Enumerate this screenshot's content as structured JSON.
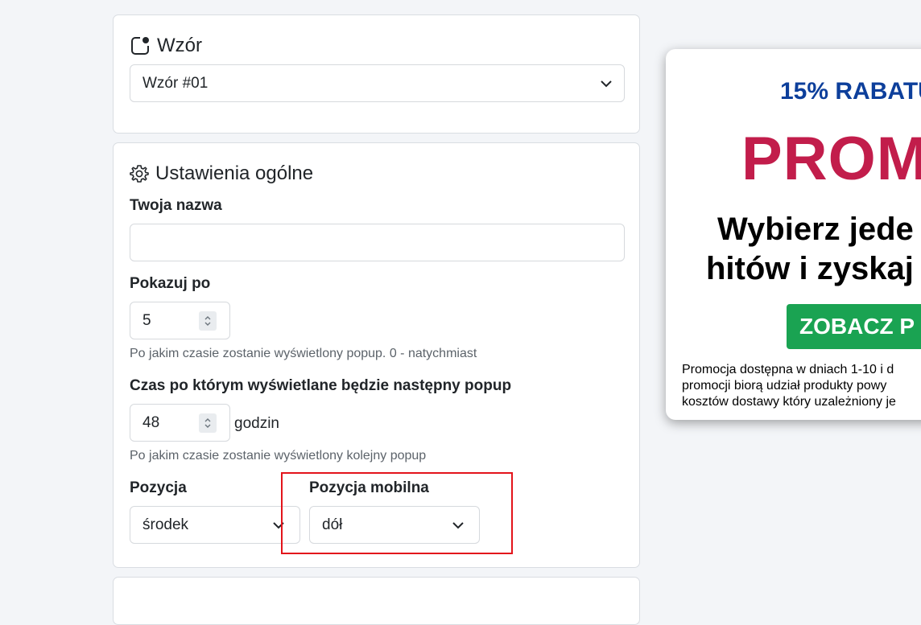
{
  "template_card": {
    "title": "Wzór",
    "icon": "notification-square-icon",
    "select_value": "Wzór #01"
  },
  "general_card": {
    "title": "Ustawienia ogólne",
    "icon": "gear-icon",
    "name_label": "Twoja nazwa",
    "name_value": "",
    "show_after_label": "Pokazuj po",
    "show_after_value": "5",
    "show_after_hint": "Po jakim czasie zostanie wyświetlony popup. 0 - natychmiast",
    "next_popup_label": "Czas po którym wyświetlane będzie następny popup",
    "next_popup_value": "48",
    "next_popup_unit": "godzin",
    "next_popup_hint": "Po jakim czasie zostanie wyświetlony kolejny popup",
    "position_label": "Pozycja",
    "position_value": "środek",
    "mobile_position_label": "Pozycja mobilna",
    "mobile_position_value": "dół"
  },
  "promo_preview": {
    "discount_text": "15% RABATU",
    "headline": "PROM",
    "subheadline_line1": "Wybierz jede",
    "subheadline_line2": "hitów i zyskaj",
    "cta_label": "ZOBACZ P",
    "fine_print_line1": "Promocja dostępna w dniach 1-10 i d",
    "fine_print_line2": "promocji biorą udział produkty powy",
    "fine_print_line3": "kosztów dostawy który uzależniony je"
  },
  "colors": {
    "page_bg": "#f3f5f8",
    "highlight_box": "#e3141b",
    "promo_blue": "#0d3f9b",
    "promo_red": "#c21d4b",
    "promo_green": "#1aa352"
  }
}
